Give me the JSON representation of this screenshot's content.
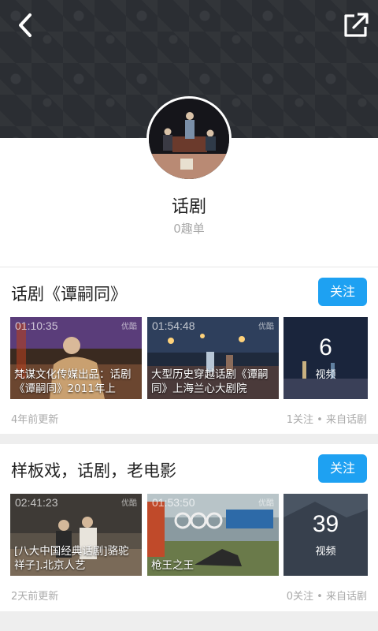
{
  "header": {
    "back_icon": "chevron-left-icon",
    "share_icon": "share-external-icon"
  },
  "profile": {
    "name": "话剧",
    "subtitle": "0趣单"
  },
  "colors": {
    "accent": "#1ea1f2",
    "header_bg": "#2b2e33",
    "muted": "#aaaaaa",
    "divider": "#eeeeee"
  },
  "cards": [
    {
      "title": "话剧《谭嗣同》",
      "follow_label": "关注",
      "videos": [
        {
          "duration": "01:10:35",
          "logo": "优酷",
          "title": "梵谋文化传媒出品：话剧《谭嗣同》2011年上"
        },
        {
          "duration": "01:54:48",
          "logo": "优酷",
          "title": "大型历史穿越话剧《谭嗣同》上海兰心大剧院"
        }
      ],
      "more_count": "6",
      "more_label": "视频",
      "updated": "4年前更新",
      "stats": "1关注 • 来自话剧"
    },
    {
      "title": "样板戏，话剧，老电影",
      "follow_label": "关注",
      "videos": [
        {
          "duration": "02:41:23",
          "logo": "优酷",
          "title": "[八大中国经典话剧]骆驼祥子].北京人艺"
        },
        {
          "duration": "01:53:50",
          "logo": "优酷",
          "title": "枪王之王"
        }
      ],
      "more_count": "39",
      "more_label": "视频",
      "updated": "2天前更新",
      "stats": "0关注 • 来自话剧"
    }
  ]
}
